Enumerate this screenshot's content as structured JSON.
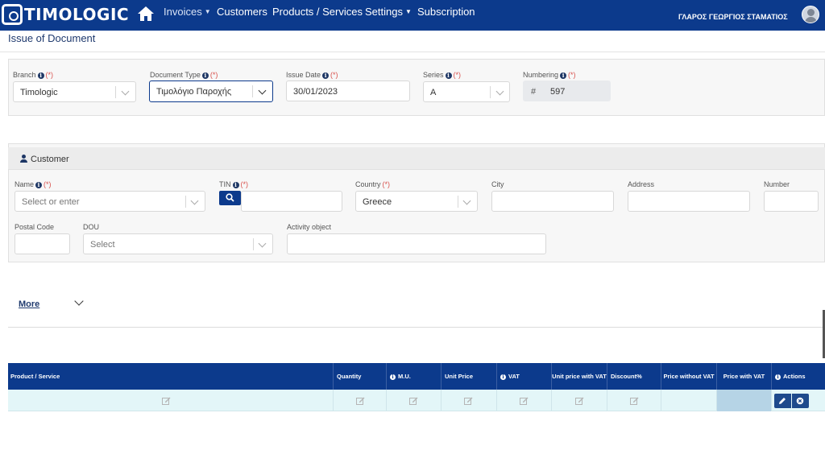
{
  "nav": {
    "logo_text": "TIMOLOGIC",
    "items": [
      {
        "label": "Invoices",
        "has_caret": true
      },
      {
        "label": "Customers"
      },
      {
        "label": "Products / Services"
      },
      {
        "label": "Settings",
        "has_caret": true
      },
      {
        "label": "Subscription"
      }
    ],
    "username": "ΓΛΑΡΟΣ ΓΕΩΡΓΙΟΣ ΣΤΑΜΑΤΙΟΣ",
    "icons": [
      "home-icon",
      "avatar-icon"
    ]
  },
  "page": {
    "title": "Issue of Document"
  },
  "document": {
    "branch": {
      "label": "Branch",
      "required": "(*)",
      "value": "Timologic"
    },
    "document_type": {
      "label": "Document Type",
      "required": "(*)",
      "value": "Τιμολόγιο Παροχής"
    },
    "issue_date": {
      "label": "Issue Date",
      "required": "(*)",
      "value": "30/01/2023"
    },
    "series": {
      "label": "Series",
      "required": "(*)",
      "value": "A"
    },
    "numbering": {
      "label": "Numbering",
      "required": "(*)",
      "prefix": "#",
      "value": "597"
    }
  },
  "customer": {
    "title": "Customer",
    "name": {
      "label": "Name",
      "required": "(*)",
      "placeholder": "Select or enter"
    },
    "tin": {
      "label": "TIN",
      "required": "(*)",
      "value": ""
    },
    "country": {
      "label": "Country",
      "required": "(*)",
      "value": "Greece"
    },
    "city": {
      "label": "City",
      "value": ""
    },
    "address": {
      "label": "Address",
      "value": ""
    },
    "number": {
      "label": "Number",
      "value": ""
    },
    "postal_code": {
      "label": "Postal Code",
      "value": ""
    },
    "dou": {
      "label": "DOU",
      "placeholder": "Select"
    },
    "activity": {
      "label": "Activity object",
      "value": ""
    }
  },
  "more": {
    "label": "More"
  },
  "table": {
    "columns": [
      {
        "label": "Product / Service"
      },
      {
        "label": "Quantity"
      },
      {
        "label": "M.U."
      },
      {
        "label": "Unit Price"
      },
      {
        "label": "VAT"
      },
      {
        "label": "Unit price with VAT"
      },
      {
        "label": "Discount%"
      },
      {
        "label": "Price without VAT"
      },
      {
        "label": "Price with VAT"
      },
      {
        "label": "Actions"
      }
    ]
  },
  "colors": {
    "nav": "#0c3a8c",
    "required": "#d9534f",
    "row": "#e3f6f8",
    "shaded_cell": "#b6d4e6"
  }
}
